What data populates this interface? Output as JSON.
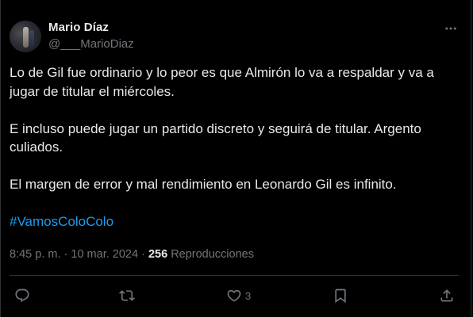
{
  "author": {
    "display_name": "Mario Díaz",
    "handle": "@___MarioDiaz"
  },
  "tweet": {
    "paragraphs": [
      "Lo de Gil fue ordinario y lo peor es que Almirón lo va a respaldar y va a\njugar de titular el miércoles.",
      "E incluso puede jugar un partido discreto y seguirá de titular. Argento\nculiados.",
      "El margen de error y mal rendimiento en Leonardo Gil es infinito."
    ],
    "hashtag": "#VamosColoColo"
  },
  "meta": {
    "time": "8:45 p. m.",
    "separator": "·",
    "date": "10 mar. 2024",
    "views_count": "256",
    "views_label": "Reproducciones"
  },
  "actions": {
    "reply_count": "",
    "retweet_count": "",
    "like_count": "3"
  },
  "icons": {
    "more": "more-dots-icon",
    "reply": "reply-bubble-icon",
    "retweet": "retweet-icon",
    "like": "heart-icon",
    "bookmark": "bookmark-icon",
    "share": "share-upload-icon"
  },
  "colors": {
    "background": "#000000",
    "text": "#e7e9ea",
    "secondary": "#71767b",
    "link": "#1d9bf0",
    "border": "#2f3336"
  }
}
